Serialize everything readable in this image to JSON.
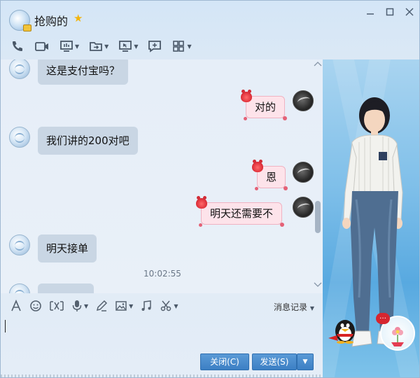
{
  "window": {
    "title": "抢购的",
    "title_star": "★",
    "controls": [
      "minimize",
      "maximize",
      "close"
    ]
  },
  "toolbar": {
    "icons": [
      "phone-icon",
      "video-icon",
      "screen-share-icon",
      "file-transfer-icon",
      "remote-desktop-icon",
      "add-chat-icon",
      "apps-grid-icon"
    ]
  },
  "messages": [
    {
      "side": "left",
      "text": "这是支付宝吗？"
    },
    {
      "side": "right",
      "text": "对的"
    },
    {
      "side": "left",
      "text": "我们讲的200对吧"
    },
    {
      "side": "right",
      "text": "恩"
    },
    {
      "side": "right",
      "text": "明天还需要不"
    },
    {
      "side": "left",
      "text": "明天接单"
    }
  ],
  "timestamp": "10:02:55",
  "input_toolbar": {
    "icons": [
      "font-icon",
      "emoji-icon",
      "gif-icon",
      "voice-icon",
      "pen-icon",
      "image-icon",
      "music-icon",
      "scissors-icon"
    ],
    "history_label": "消息记录"
  },
  "buttons": {
    "close": "关闭(C)",
    "send": "发送(S)",
    "send_dropdown": "▼"
  },
  "panel": {
    "badge_text": "…"
  },
  "colors": {
    "accent_button": "#3c7fc4",
    "left_bubble": "#c9d6e4",
    "right_bubble": "#fde3ea",
    "star": "#f3b40c"
  }
}
